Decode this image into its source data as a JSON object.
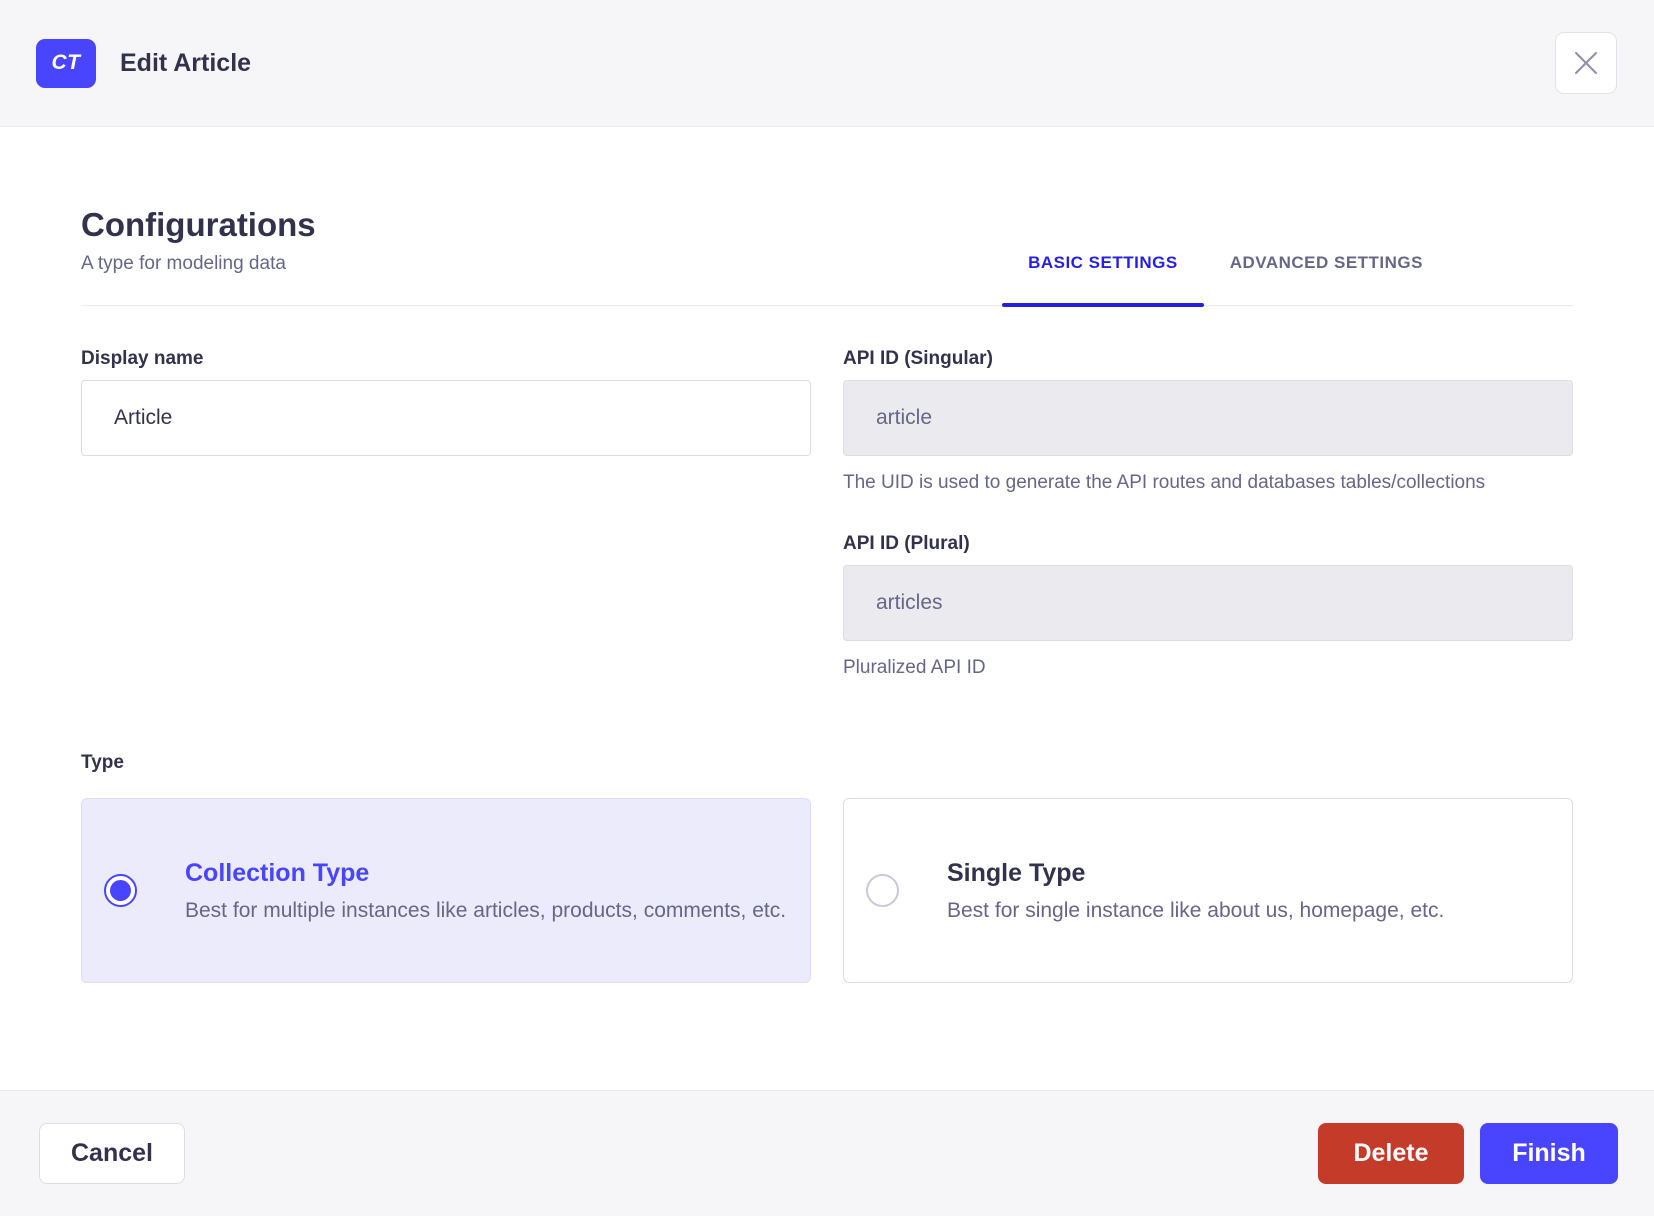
{
  "header": {
    "badge": "CT",
    "title": "Edit Article"
  },
  "heading": {
    "title": "Configurations",
    "subtitle": "A type for modeling data"
  },
  "tabs": [
    {
      "label": "BASIC SETTINGS",
      "active": true
    },
    {
      "label": "ADVANCED SETTINGS",
      "active": false
    }
  ],
  "form": {
    "display_name": {
      "label": "Display name",
      "value": "Article"
    },
    "api_id_singular": {
      "label": "API ID (Singular)",
      "value": "article",
      "hint": "The UID is used to generate the API routes and databases tables/collections",
      "disabled": true
    },
    "api_id_plural": {
      "label": "API ID (Plural)",
      "value": "articles",
      "hint": "Pluralized API ID",
      "disabled": true
    },
    "type": {
      "label": "Type",
      "options": [
        {
          "title": "Collection Type",
          "description": "Best for multiple instances like articles, products, comments, etc.",
          "selected": true
        },
        {
          "title": "Single Type",
          "description": "Best for single instance like about us, homepage, etc.",
          "selected": false
        }
      ]
    }
  },
  "footer": {
    "cancel": "Cancel",
    "delete": "Delete",
    "finish": "Finish"
  },
  "colors": {
    "primary": "#4945ff",
    "tab_active": "#271fe0",
    "danger": "#c53b2a",
    "header_footer_bg": "#f6f6f9",
    "selected_card_bg": "#ecebfb",
    "text_dark": "#32324d",
    "text_gray": "#666687"
  }
}
